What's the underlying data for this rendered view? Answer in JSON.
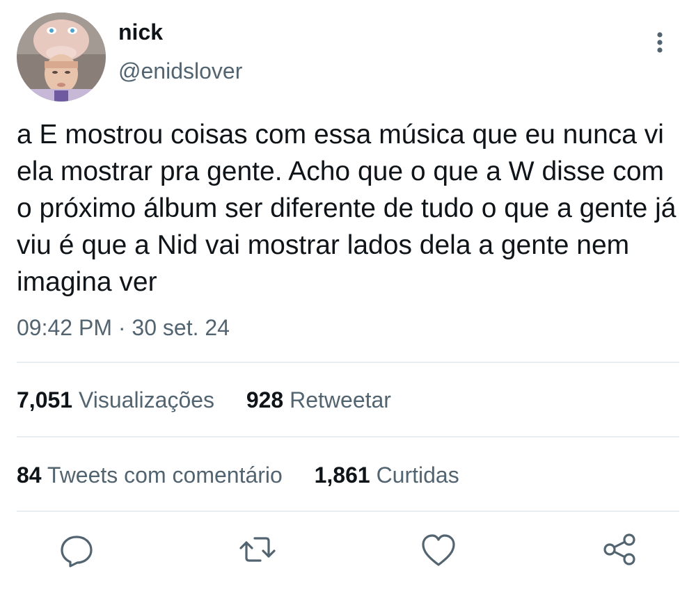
{
  "author": {
    "name": "nick",
    "handle": "@enidslover"
  },
  "tweet": {
    "text": "a E mostrou coisas com essa música que eu nunca vi ela mostrar pra gente. Acho que o que a W disse com o próximo álbum ser diferente de tudo o que a gente já viu é que a Nid vai mostrar lados dela a gente nem imagina ver",
    "timestamp": "09:42 PM · 30 set. 24"
  },
  "stats": {
    "views_count": "7,051",
    "views_label": "Visualizações",
    "retweets_count": "928",
    "retweets_label": "Retweetar",
    "quotes_count": "84",
    "quotes_label": "Tweets com comentário",
    "likes_count": "1,861",
    "likes_label": "Curtidas"
  },
  "icons": {
    "more": "more-vertical-icon",
    "reply": "reply-icon",
    "retweet": "retweet-icon",
    "like": "heart-icon",
    "share": "share-icon"
  },
  "colors": {
    "text": "#0f1419",
    "secondary": "#536471",
    "divider": "#e6ecf0",
    "icon": "#536471"
  }
}
